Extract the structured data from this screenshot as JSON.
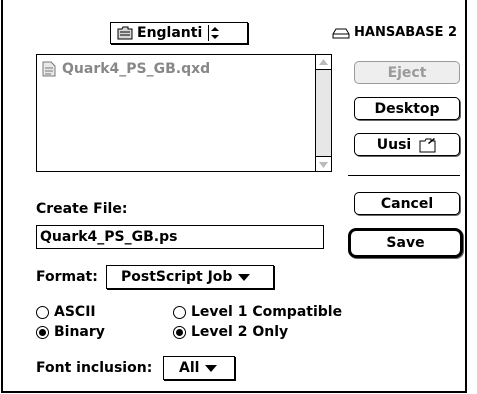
{
  "volume_popup": {
    "label": "Englanti"
  },
  "disk": {
    "name": "HANSABASE 2"
  },
  "file_list": {
    "items": [
      "Quark4_PS_GB.qxd"
    ]
  },
  "buttons": {
    "eject": "Eject",
    "desktop": "Desktop",
    "new_folder": "Uusi",
    "cancel": "Cancel",
    "save": "Save"
  },
  "create_file": {
    "label": "Create File:",
    "value": "Quark4_PS_GB.ps"
  },
  "format": {
    "label": "Format:",
    "selected": "PostScript Job"
  },
  "encoding": {
    "options": [
      "ASCII",
      "Binary"
    ],
    "selected": "Binary"
  },
  "level": {
    "options": [
      "Level 1 Compatible",
      "Level 2 Only"
    ],
    "selected": "Level 2 Only"
  },
  "font_inclusion": {
    "label": "Font inclusion:",
    "selected": "All"
  }
}
